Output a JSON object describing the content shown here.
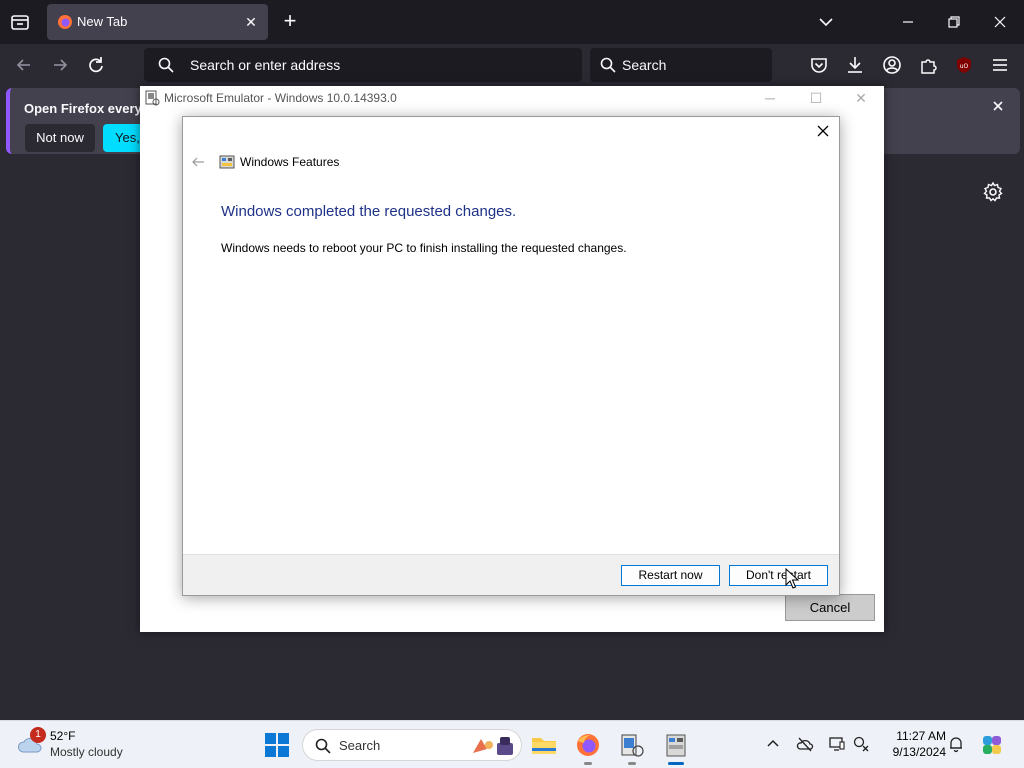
{
  "browser": {
    "tab": {
      "title": "New Tab"
    },
    "urlbar": {
      "placeholder": "Search or enter address"
    },
    "searchbar": {
      "placeholder": "Search"
    },
    "notification": {
      "message": "Open Firefox every ti",
      "not_now": "Not now",
      "yes": "Yes, d"
    }
  },
  "emulator": {
    "title": "Microsoft Emulator - Windows 10.0.14393.0",
    "cancel": "Cancel"
  },
  "dialog": {
    "section_title": "Windows Features",
    "heading": "Windows completed the requested changes.",
    "body": "Windows needs to reboot your PC to finish installing the requested changes.",
    "restart_now": "Restart now",
    "dont_restart": "Don't restart"
  },
  "taskbar": {
    "weather": {
      "badge": "1",
      "temp": "52°F",
      "condition": "Mostly cloudy"
    },
    "search_label": "Search",
    "clock": {
      "time": "11:27 AM",
      "date": "9/13/2024"
    }
  },
  "colors": {
    "accent_firefox": "#00ddff",
    "dialog_heading": "#1e3287",
    "windows_accent": "#0078d7"
  }
}
